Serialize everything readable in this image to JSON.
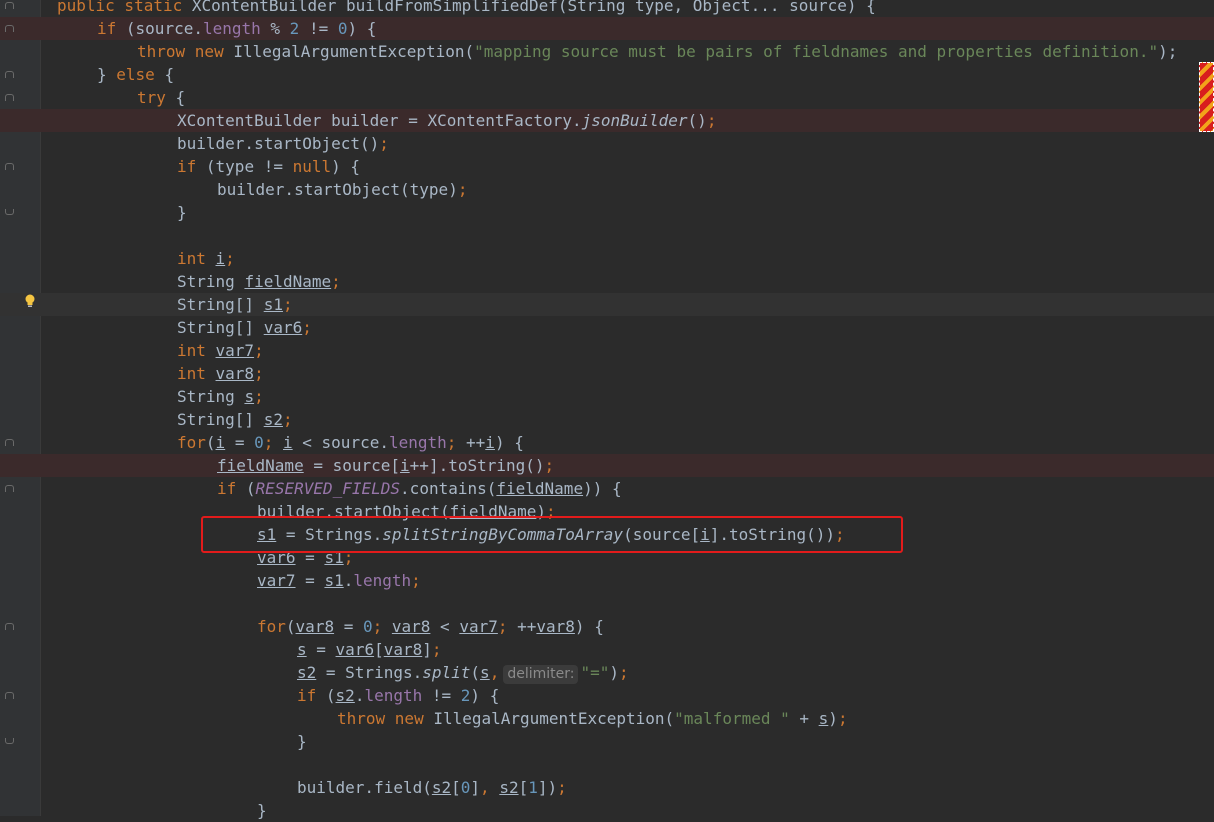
{
  "editor": {
    "lines": [
      [
        [
          "kw",
          "public static "
        ],
        [
          "",
          "XContentBuilder buildFromSimplifiedDef(String type, Object... source) {"
        ]
      ],
      [
        [
          "kw",
          "if "
        ],
        [
          "",
          "(source."
        ],
        [
          "fld",
          "length"
        ],
        [
          "",
          " % "
        ],
        [
          "num",
          "2"
        ],
        [
          "",
          " != "
        ],
        [
          "num",
          "0"
        ],
        [
          "",
          ") {"
        ]
      ],
      [
        [
          "kw",
          "throw new "
        ],
        [
          "",
          "IllegalArgumentException("
        ],
        [
          "str",
          "\"mapping source must be pairs of fieldnames and properties definition.\""
        ],
        [
          "",
          ");"
        ]
      ],
      [
        [
          "",
          "} "
        ],
        [
          "kw",
          "else "
        ],
        [
          "",
          "{"
        ]
      ],
      [
        [
          "kw",
          "try "
        ],
        [
          "",
          "{"
        ]
      ],
      [
        [
          "",
          "XContentBuilder builder = XContentFactory."
        ],
        [
          "it",
          "jsonBuilder"
        ],
        [
          "",
          "()"
        ],
        [
          "kw",
          ";"
        ]
      ],
      [
        [
          "",
          "builder.startObject()"
        ],
        [
          "kw",
          ";"
        ]
      ],
      [
        [
          "kw",
          "if "
        ],
        [
          "",
          "(type != "
        ],
        [
          "kw",
          "null"
        ],
        [
          "",
          ") {"
        ]
      ],
      [
        [
          "",
          "builder.startObject(type)"
        ],
        [
          "kw",
          ";"
        ]
      ],
      [
        [
          "",
          "}"
        ]
      ],
      [],
      [
        [
          "kw",
          "int "
        ],
        [
          "ul",
          "i"
        ],
        [
          "kw",
          ";"
        ]
      ],
      [
        [
          "",
          "String "
        ],
        [
          "ul",
          "fieldName"
        ],
        [
          "kw",
          ";"
        ]
      ],
      [
        [
          "",
          "String[] "
        ],
        [
          "ul",
          "s1"
        ],
        [
          "kw",
          ";"
        ]
      ],
      [
        [
          "",
          "String[] "
        ],
        [
          "ul",
          "var6"
        ],
        [
          "kw",
          ";"
        ]
      ],
      [
        [
          "kw",
          "int "
        ],
        [
          "ul",
          "var7"
        ],
        [
          "kw",
          ";"
        ]
      ],
      [
        [
          "kw",
          "int "
        ],
        [
          "ul",
          "var8"
        ],
        [
          "kw",
          ";"
        ]
      ],
      [
        [
          "",
          "String "
        ],
        [
          "ul",
          "s"
        ],
        [
          "kw",
          ";"
        ]
      ],
      [
        [
          "",
          "String[] "
        ],
        [
          "ul",
          "s2"
        ],
        [
          "kw",
          ";"
        ]
      ],
      [
        [
          "kw",
          "for"
        ],
        [
          "",
          "("
        ],
        [
          "ul",
          "i"
        ],
        [
          "",
          " = "
        ],
        [
          "num",
          "0"
        ],
        [
          "kw",
          "; "
        ],
        [
          "ul",
          "i"
        ],
        [
          "",
          " < source."
        ],
        [
          "fld",
          "length"
        ],
        [
          "kw",
          "; "
        ],
        [
          "",
          "++"
        ],
        [
          "ul",
          "i"
        ],
        [
          "",
          ") {"
        ]
      ],
      [
        [
          "ul",
          "fieldName"
        ],
        [
          "",
          " = source["
        ],
        [
          "ul",
          "i"
        ],
        [
          "",
          "++].toString()"
        ],
        [
          "kw",
          ";"
        ]
      ],
      [
        [
          "kw",
          "if "
        ],
        [
          "",
          "("
        ],
        [
          "cst",
          "RESERVED_FIELDS"
        ],
        [
          "",
          ".contains("
        ],
        [
          "ul",
          "fieldName"
        ],
        [
          "",
          ")) {"
        ]
      ],
      [
        [
          "",
          "builder.startObject("
        ],
        [
          "ul",
          "fieldName"
        ],
        [
          "",
          ")"
        ],
        [
          "kw",
          ";"
        ]
      ],
      [
        [
          "ul",
          "s1"
        ],
        [
          "",
          " = Strings."
        ],
        [
          "it",
          "splitStringByCommaToArray"
        ],
        [
          "",
          "(source["
        ],
        [
          "ul",
          "i"
        ],
        [
          "",
          "].toString())"
        ],
        [
          "kw",
          ";"
        ]
      ],
      [
        [
          "ul",
          "var6"
        ],
        [
          "",
          " = "
        ],
        [
          "ul",
          "s1"
        ],
        [
          "kw",
          ";"
        ]
      ],
      [
        [
          "ul",
          "var7"
        ],
        [
          "",
          " = "
        ],
        [
          "ul",
          "s1"
        ],
        [
          "",
          "."
        ],
        [
          "fld",
          "length"
        ],
        [
          "kw",
          ";"
        ]
      ],
      [],
      [
        [
          "kw",
          "for"
        ],
        [
          "",
          "("
        ],
        [
          "ul",
          "var8"
        ],
        [
          "",
          " = "
        ],
        [
          "num",
          "0"
        ],
        [
          "kw",
          "; "
        ],
        [
          "ul",
          "var8"
        ],
        [
          "",
          " < "
        ],
        [
          "ul",
          "var7"
        ],
        [
          "kw",
          "; "
        ],
        [
          "",
          "++"
        ],
        [
          "ul",
          "var8"
        ],
        [
          "",
          ") {"
        ]
      ],
      [
        [
          "ul",
          "s"
        ],
        [
          "",
          " = "
        ],
        [
          "ul",
          "var6"
        ],
        [
          "",
          "["
        ],
        [
          "ul",
          "var8"
        ],
        [
          "",
          "]"
        ],
        [
          "kw",
          ";"
        ]
      ],
      [
        [
          "ul",
          "s2"
        ],
        [
          "",
          " = Strings."
        ],
        [
          "it",
          "split"
        ],
        [
          "",
          "("
        ],
        [
          "ul",
          "s"
        ],
        [
          "kw",
          ","
        ],
        [
          "hint",
          "delimiter:"
        ],
        [
          "str",
          "\"=\""
        ],
        [
          "",
          ")"
        ],
        [
          "kw",
          ";"
        ]
      ],
      [
        [
          "kw",
          "if "
        ],
        [
          "",
          "("
        ],
        [
          "ul",
          "s2"
        ],
        [
          "",
          "."
        ],
        [
          "fld",
          "length"
        ],
        [
          "",
          " != "
        ],
        [
          "num",
          "2"
        ],
        [
          "",
          ") {"
        ]
      ],
      [
        [
          "kw",
          "throw new "
        ],
        [
          "",
          "IllegalArgumentException("
        ],
        [
          "str",
          "\"malformed \""
        ],
        [
          "",
          " + "
        ],
        [
          "ul",
          "s"
        ],
        [
          "",
          ")"
        ],
        [
          "kw",
          ";"
        ]
      ],
      [
        [
          "",
          "}"
        ]
      ],
      [],
      [
        [
          "",
          "builder.field("
        ],
        [
          "ul",
          "s2"
        ],
        [
          "",
          "["
        ],
        [
          "num",
          "0"
        ],
        [
          "",
          "]"
        ],
        [
          "kw",
          ", "
        ],
        [
          "ul",
          "s2"
        ],
        [
          "",
          "["
        ],
        [
          "num",
          "1"
        ],
        [
          "",
          "])"
        ],
        [
          "kw",
          ";"
        ]
      ],
      [
        [
          "",
          "}"
        ]
      ]
    ],
    "colors": {
      "background": "#2b2b2b",
      "keyword": "#cc7832",
      "field": "#9876aa",
      "number": "#6897bb",
      "string": "#6a8759",
      "text": "#a9b7c6",
      "highlight_box": "#e21b1b"
    },
    "icons": [
      "lightbulb-icon",
      "fold-marker-icon"
    ]
  }
}
